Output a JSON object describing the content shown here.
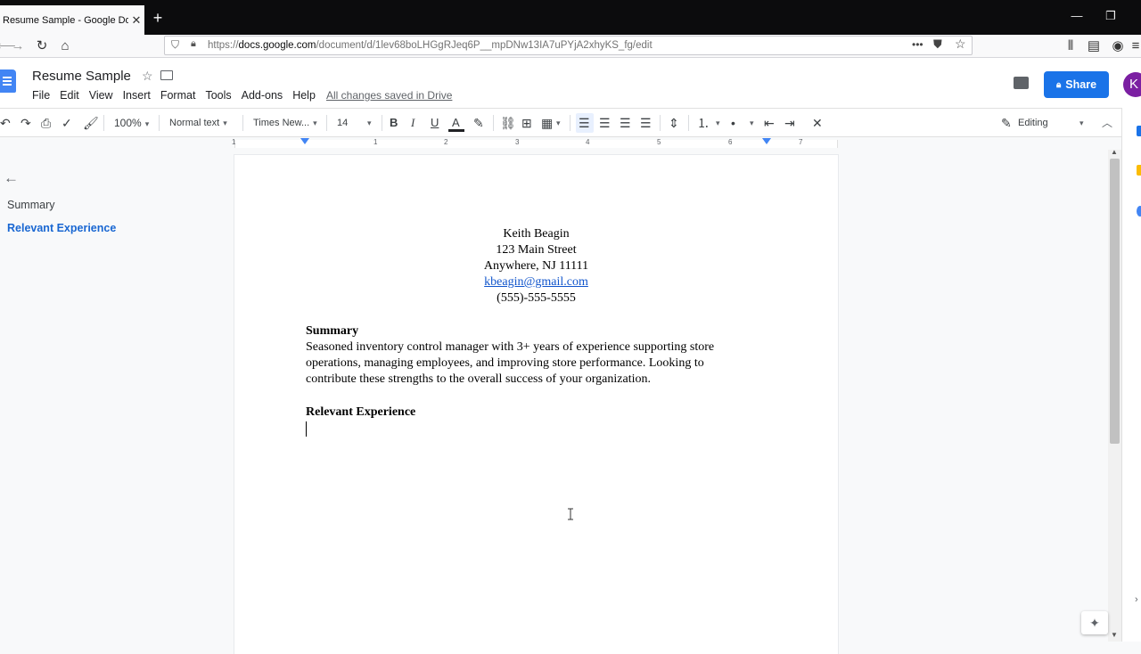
{
  "browser": {
    "tab_title": "Resume Sample - Google Docs",
    "tab_close": "✕",
    "new_tab": "+",
    "url_host": "docs.google.com",
    "url_prefix": "https://",
    "url_path": "/document/d/1lev68boLHGgRJeq6P__mpDNw13IA7uPYjA2xhyKS_fg/edit",
    "window_controls": [
      "—",
      "❐"
    ]
  },
  "docs": {
    "title": "Resume Sample",
    "menus": [
      "File",
      "Edit",
      "View",
      "Insert",
      "Format",
      "Tools",
      "Add-ons",
      "Help"
    ],
    "saved_status": "All changes saved in Drive",
    "share_label": "Share",
    "avatar_initial": "K"
  },
  "toolbar": {
    "zoom": "100%",
    "style": "Normal text",
    "font": "Times New...",
    "font_size": "14",
    "bold": "B",
    "italic": "I",
    "underline": "U",
    "text_color": "A",
    "mode": "Editing"
  },
  "ruler": {
    "labels": [
      "1",
      "1",
      "2",
      "3",
      "4",
      "5",
      "6",
      "7"
    ]
  },
  "outline": {
    "items": [
      "Summary",
      "Relevant Experience"
    ],
    "active_index": 1
  },
  "document": {
    "name": "Keith Beagin",
    "street": "123 Main Street",
    "city": "Anywhere, NJ 11111",
    "email": "kbeagin@gmail.com",
    "phone": "(555)-555-5555",
    "summary_heading": "Summary",
    "summary_lines": [
      "Seasoned inventory control manager with 3+ years of experience supporting store",
      "operations, managing employees, and improving store performance. Looking to",
      "contribute these strengths to the overall success of your organization."
    ],
    "experience_heading": "Relevant Experience"
  },
  "colors": {
    "accent": "#1a73e8",
    "link": "#1155cc",
    "outline_active": "#1967d2",
    "avatar": "#7b1fa2"
  }
}
